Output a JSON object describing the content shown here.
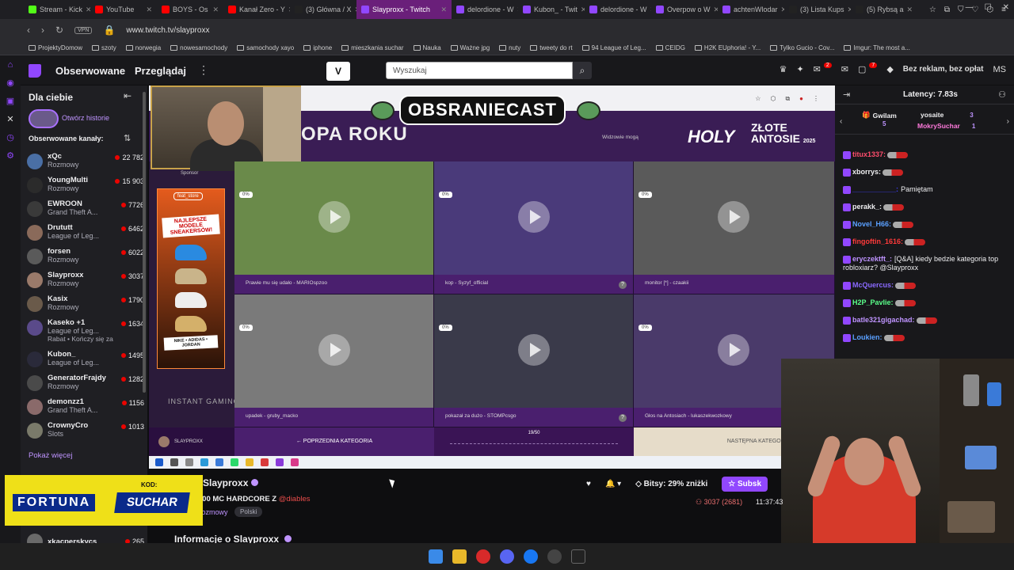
{
  "browser": {
    "tabs": [
      {
        "label": "Stream - Kick",
        "color": "#53fc18"
      },
      {
        "label": "YouTube",
        "color": "#ff0000"
      },
      {
        "label": "BOYS - Os",
        "color": "#ff0000"
      },
      {
        "label": "Kanał Zero - Y",
        "color": "#ff0000"
      },
      {
        "label": "(3) Główna / X",
        "color": "#222222"
      },
      {
        "label": "Slayproxx - Twitch",
        "color": "#9147ff",
        "active": true
      },
      {
        "label": "delordione - W",
        "color": "#9147ff"
      },
      {
        "label": "Kubon_ - Twit",
        "color": "#9147ff"
      },
      {
        "label": "delordione - W",
        "color": "#9147ff"
      },
      {
        "label": "Overpow o W",
        "color": "#9147ff"
      },
      {
        "label": "achtenWlodar",
        "color": "#9147ff"
      },
      {
        "label": "(3) Lista Kups",
        "color": "#222222"
      },
      {
        "label": "(5) Rybsą a",
        "color": "#222222"
      }
    ],
    "url": "www.twitch.tv/slayproxx",
    "vpn_label": "VPN",
    "bookmarks": [
      "ProjektyDomow",
      "szoty",
      "norwegia",
      "nowesamochody",
      "samochody xayo",
      "iphone",
      "mieszkania suchar",
      "Nauka",
      "Ważne jpg",
      "nuty",
      "tweety do rt",
      "94 League of Leg...",
      "CEIDG",
      "H2K EUphoria! - Y...",
      "Tylko Gucio - Cov...",
      "Imgur: The most a..."
    ]
  },
  "nav": {
    "followed": "Obserwowane",
    "browse": "Przeglądaj",
    "more": "⋮",
    "box_label": "V",
    "search_placeholder": "Wyszukaj",
    "notif_count": "2",
    "inbox_count": "7",
    "adfree": "Bez reklam, bez opłat",
    "user_initials": "MS"
  },
  "sidebar": {
    "title": "Dla ciebie",
    "stories": "Otwórz historie",
    "followed_label": "Obserwowane kanały:",
    "channels": [
      {
        "name": "xQc",
        "game": "Rozmowy",
        "viewers": "22 782",
        "color": "#4a6fa5"
      },
      {
        "name": "YoungMulti",
        "game": "Rozmowy",
        "viewers": "15 903",
        "color": "#2b2b2b"
      },
      {
        "name": "EWROON",
        "game": "Grand Theft A...",
        "viewers": "7726",
        "color": "#3a3a3a"
      },
      {
        "name": "Drututt",
        "game": "League of Leg...",
        "viewers": "6462",
        "color": "#8a6a5a"
      },
      {
        "name": "forsen",
        "game": "Rozmowy",
        "viewers": "6022",
        "color": "#5a5a5a"
      },
      {
        "name": "Slayproxx",
        "game": "Rozmowy",
        "viewers": "3037",
        "color": "#9a7a6a"
      },
      {
        "name": "Kasix",
        "game": "Rozmowy",
        "viewers": "1790",
        "color": "#6a5a4a"
      },
      {
        "name": "Kaseko +1",
        "game": "League of Leg...",
        "viewers": "1634",
        "sub": "Rabat • Kończy się za",
        "color": "#5a4a8a"
      },
      {
        "name": "Kubon_",
        "game": "League of Leg...",
        "viewers": "1495",
        "color": "#2a2a3a"
      },
      {
        "name": "GeneratorFrajdy",
        "game": "Rozmowy",
        "viewers": "1282",
        "color": "#4a4a4a"
      },
      {
        "name": "demonzz1",
        "game": "Grand Theft A...",
        "viewers": "1156",
        "color": "#8a6a6a"
      },
      {
        "name": "CrownyCro",
        "game": "Slots",
        "viewers": "1013",
        "color": "#7a7a6a"
      }
    ],
    "show_more": "Pokaż więcej",
    "last_channel": {
      "name": "xkacperskycs",
      "viewers": "265"
    }
  },
  "player": {
    "podcast_title": "OBSRANIECAST",
    "category_title": "OPA ROKU",
    "widzowie": "Widzowie mogą",
    "holy": "HOLY",
    "zlote": "ZŁOTE ANTOSIE",
    "year": "2025",
    "sponsor": "Sponsor",
    "promo_feat": "feat_store",
    "promo_headline": "NAJLEPSZE MODELE SNEAKERSÓW!",
    "promo_brands": "NIKE • ADIDAS • JORDAN",
    "instant": "INSTANT GAMING",
    "grid": [
      {
        "caption": "Prawie mu się udało - MARIOspzoo",
        "pct": "0%",
        "bg": "#6a8a4a"
      },
      {
        "caption": "kop - Syzyf_official",
        "pct": "0%",
        "bg": "#4a3a7a"
      },
      {
        "caption": "monitor [*] - czaakii",
        "pct": "0%",
        "bg": "#5a5a5a"
      },
      {
        "caption": "upadek - gruby_macko",
        "pct": "0%",
        "bg": "#7a7a7a"
      },
      {
        "caption": "pokazał za dużo - STOMPcsgo",
        "pct": "0%",
        "bg": "#3a3a4a"
      },
      {
        "caption": "Głos na Antosiach - lukaszekwozkowy",
        "pct": "0%",
        "bg": "#4a3a6a"
      }
    ],
    "bottom_user": "SLAYPROXX",
    "prev_label": "POPRZEDNIA KATEGORIA",
    "counter": "19/50",
    "next_label": "NASTĘPNA KATEGORIA"
  },
  "chat": {
    "latency": "Latency: 7.83s",
    "gifts": [
      {
        "user": "Gwilam",
        "count": "5"
      },
      {
        "user": "yosaite",
        "count": "3"
      },
      {
        "user": "MokrySuchar",
        "count": "1"
      }
    ],
    "messages": [
      {
        "user": "titux1337:",
        "color": "#ff4d6d",
        "text": ""
      },
      {
        "user": "xborrys:",
        "color": "#efeff1",
        "text": ""
      },
      {
        "user": "___________:",
        "color": "#4040ff",
        "text": "Pamiętam"
      },
      {
        "user": "perakk_:",
        "color": "#efeff1",
        "text": ""
      },
      {
        "user": "Novel_H66:",
        "color": "#5aa0ff",
        "text": ""
      },
      {
        "user": "fingoftin_1616:",
        "color": "#ff3a3a",
        "text": ""
      },
      {
        "user": "eryczektft_:",
        "color": "#bf94ff",
        "text": "[Q&A] kiedy bedzie kategoria top robloxiarz? @Slayproxx"
      },
      {
        "user": "McQuercus:",
        "color": "#8a6aff",
        "text": ""
      },
      {
        "user": "H2P_Pavlie:",
        "color": "#5aff8a",
        "text": ""
      },
      {
        "user": "batle321gigachad:",
        "color": "#bf94ff",
        "text": ""
      },
      {
        "user": "Loukien:",
        "color": "#5aa0ff",
        "text": ""
      }
    ]
  },
  "stream_info": {
    "name": "Slayproxx",
    "title_prefix": ":00 MC HARDCORE Z",
    "mention": "@diables",
    "category": "Rozmowy",
    "language": "Polski",
    "bits": "Bitsy: 29% zniżki",
    "subscribe": "Subsk",
    "viewers": "3037 (2681)",
    "uptime": "11:37:43",
    "info_heading": "Informacje o Slayproxx"
  },
  "ad": {
    "brand": "FORTUNA",
    "kod_label": "KOD:",
    "code": "SUCHAR"
  }
}
